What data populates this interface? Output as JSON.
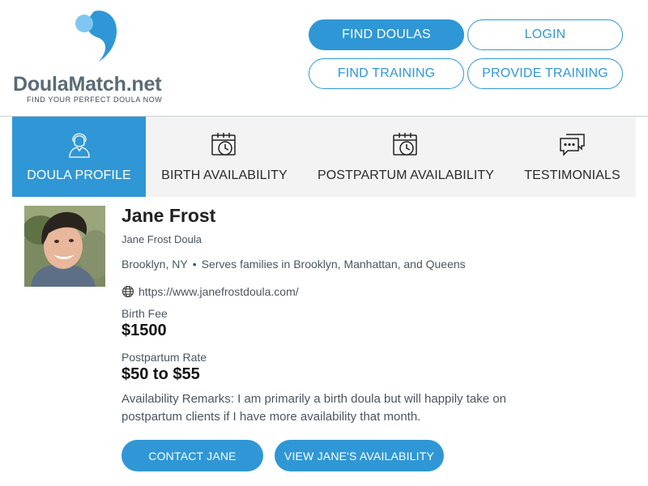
{
  "brand": {
    "name_main": "DoulaMatch",
    "name_suffix": ".net",
    "tagline": "FIND YOUR PERFECT DOULA NOW",
    "accent_color": "#2f97d6"
  },
  "nav": {
    "find_doulas": "FIND DOULAS",
    "login": "LOGIN",
    "find_training": "FIND TRAINING",
    "provide_training": "PROVIDE TRAINING"
  },
  "tabs": [
    {
      "label": "DOULA PROFILE",
      "icon": "person-icon",
      "active": true
    },
    {
      "label": "BIRTH AVAILABILITY",
      "icon": "calendar-clock-icon",
      "active": false
    },
    {
      "label": "POSTPARTUM AVAILABILITY",
      "icon": "calendar-clock-icon",
      "active": false
    },
    {
      "label": "TESTIMONIALS",
      "icon": "chat-bubbles-icon",
      "active": false
    }
  ],
  "profile": {
    "name": "Jane Frost",
    "business": "Jane Frost Doula",
    "city": "Brooklyn, NY",
    "service_area": "Serves families in Brooklyn, Manhattan, and Queens",
    "website": "https://www.janefrostdoula.com/",
    "birth_fee_label": "Birth Fee",
    "birth_fee": "$1500",
    "postpartum_rate_label": "Postpartum Rate",
    "postpartum_rate": "$50 to $55",
    "remarks": "Availability Remarks: I am primarily a birth doula but will happily take on postpartum clients if I have more availability that month."
  },
  "actions": {
    "contact": "CONTACT JANE",
    "view_availability": "VIEW JANE'S AVAILABILITY"
  }
}
